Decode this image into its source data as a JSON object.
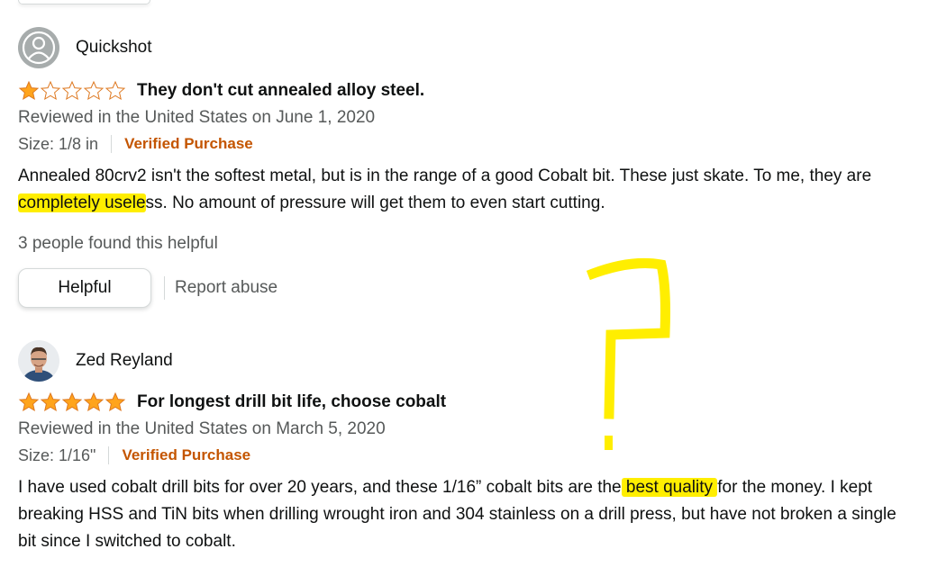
{
  "colors": {
    "star": "#ffa41c",
    "verified": "#c45500",
    "highlight": "#ffee00",
    "muted_text": "#565959"
  },
  "reviews": [
    {
      "reviewer": "Quickshot",
      "avatar": "default-avatar-icon",
      "rating": 1,
      "title": "They don't cut annealed alloy steel.",
      "date": "Reviewed in the United States on June 1, 2020",
      "size": "Size: 1/8 in",
      "verified": "Verified Purchase",
      "body_a": "Annealed 80crv2 isn't the softest metal, but is in the range of a good Cobalt bit. These just skate. To me, they are ",
      "body_hl": "completely usele",
      "body_b": "ss. No amount of pressure will get them to even start cutting.",
      "helpful_count": "3 people found this helpful",
      "helpful_label": "Helpful",
      "report_label": "Report abuse"
    },
    {
      "reviewer": "Zed Reyland",
      "avatar": "user-photo",
      "rating": 5,
      "title": "For longest drill bit life, choose cobalt",
      "date": "Reviewed in the United States on March 5, 2020",
      "size": "Size: 1/16\"",
      "verified": "Verified Purchase",
      "body_a": "I have used cobalt drill bits for over 20 years, and these 1/16” cobalt bits are the",
      "body_hl": " best quality ",
      "body_b": "for the money. I kept breaking HSS and TiN bits when drilling wrought iron and 304 stainless on a drill press, but have not broken a single bit since I switched to cobalt."
    }
  ],
  "annotation": {
    "icon": "question-mark-annotation"
  }
}
